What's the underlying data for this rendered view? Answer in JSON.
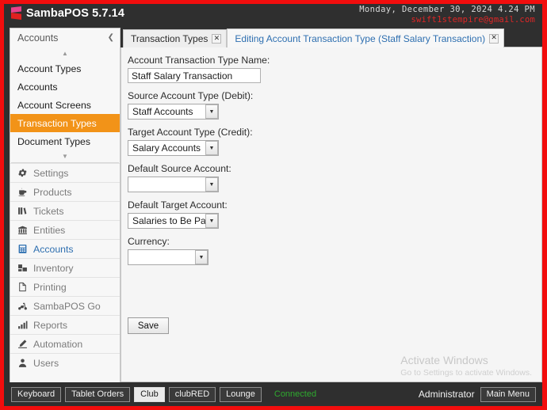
{
  "window": {
    "app_title": "SambaPOS 5.7.14",
    "logo_icon": "sambapos-logo-icon",
    "border_color": "#f20d0d",
    "titlebar_color": "#2f2f2f"
  },
  "header": {
    "datetime": "Monday, December 30, 2024 4.24 PM",
    "user_email": "swift1stempire@gmail.com",
    "email_color": "#e02626"
  },
  "sidebar": {
    "title": "Accounts",
    "collapse_icon": "chevron-left-icon",
    "scroll_up_icon": "chevron-up-icon",
    "scroll_down_icon": "chevron-down-icon",
    "selected_color": "#f29318",
    "sub_items": [
      {
        "label": "Account Types",
        "selected": false
      },
      {
        "label": "Accounts",
        "selected": false
      },
      {
        "label": "Account Screens",
        "selected": false
      },
      {
        "label": "Transaction Types",
        "selected": true
      },
      {
        "label": "Document Types",
        "selected": false
      }
    ],
    "nav_items": [
      {
        "label": "Settings",
        "icon": "gear-icon",
        "active": false
      },
      {
        "label": "Products",
        "icon": "coffee-cup-icon",
        "active": false
      },
      {
        "label": "Tickets",
        "icon": "books-icon",
        "active": false
      },
      {
        "label": "Entities",
        "icon": "bank-building-icon",
        "active": false
      },
      {
        "label": "Accounts",
        "icon": "calculator-icon",
        "active": true
      },
      {
        "label": "Inventory",
        "icon": "boxes-icon",
        "active": false
      },
      {
        "label": "Printing",
        "icon": "page-icon",
        "active": false
      },
      {
        "label": "SambaPOS Go",
        "icon": "scooter-icon",
        "active": false
      },
      {
        "label": "Reports",
        "icon": "bar-chart-icon",
        "active": false
      },
      {
        "label": "Automation",
        "icon": "pen-icon",
        "active": false
      },
      {
        "label": "Users",
        "icon": "user-icon",
        "active": false
      }
    ]
  },
  "tabs": [
    {
      "label": "Transaction Types",
      "active": false,
      "close_icon": "close-icon"
    },
    {
      "label": "Editing Account Transaction Type (Staff Salary Transaction)",
      "active": true,
      "close_icon": "close-icon"
    }
  ],
  "form": {
    "fields": [
      {
        "label": "Account Transaction Type Name:",
        "type": "text",
        "value": "Staff Salary Transaction",
        "placeholder": ""
      },
      {
        "label": "Source Account Type (Debit):",
        "type": "combo",
        "value": "Staff Accounts"
      },
      {
        "label": "Target Account Type (Credit):",
        "type": "combo",
        "value": "Salary Accounts"
      },
      {
        "label": "Default Source Account:",
        "type": "combo",
        "value": ""
      },
      {
        "label": "Default Target Account:",
        "type": "combo",
        "value": "Salaries to Be Paid"
      },
      {
        "label": "Currency:",
        "type": "combo-narrow",
        "value": ""
      }
    ],
    "save_label": "Save"
  },
  "watermark": {
    "line1": "Activate Windows",
    "line2": "Go to Settings to activate Windows."
  },
  "statusbar": {
    "buttons": [
      {
        "label": "Keyboard",
        "active": false
      },
      {
        "label": "Tablet Orders",
        "active": false
      },
      {
        "label": "Club",
        "active": true
      },
      {
        "label": "clubRED",
        "active": false
      },
      {
        "label": "Lounge",
        "active": false
      }
    ],
    "connection_status": "Connected",
    "connection_color": "#2faa2f",
    "user": "Administrator",
    "main_menu_label": "Main Menu"
  }
}
